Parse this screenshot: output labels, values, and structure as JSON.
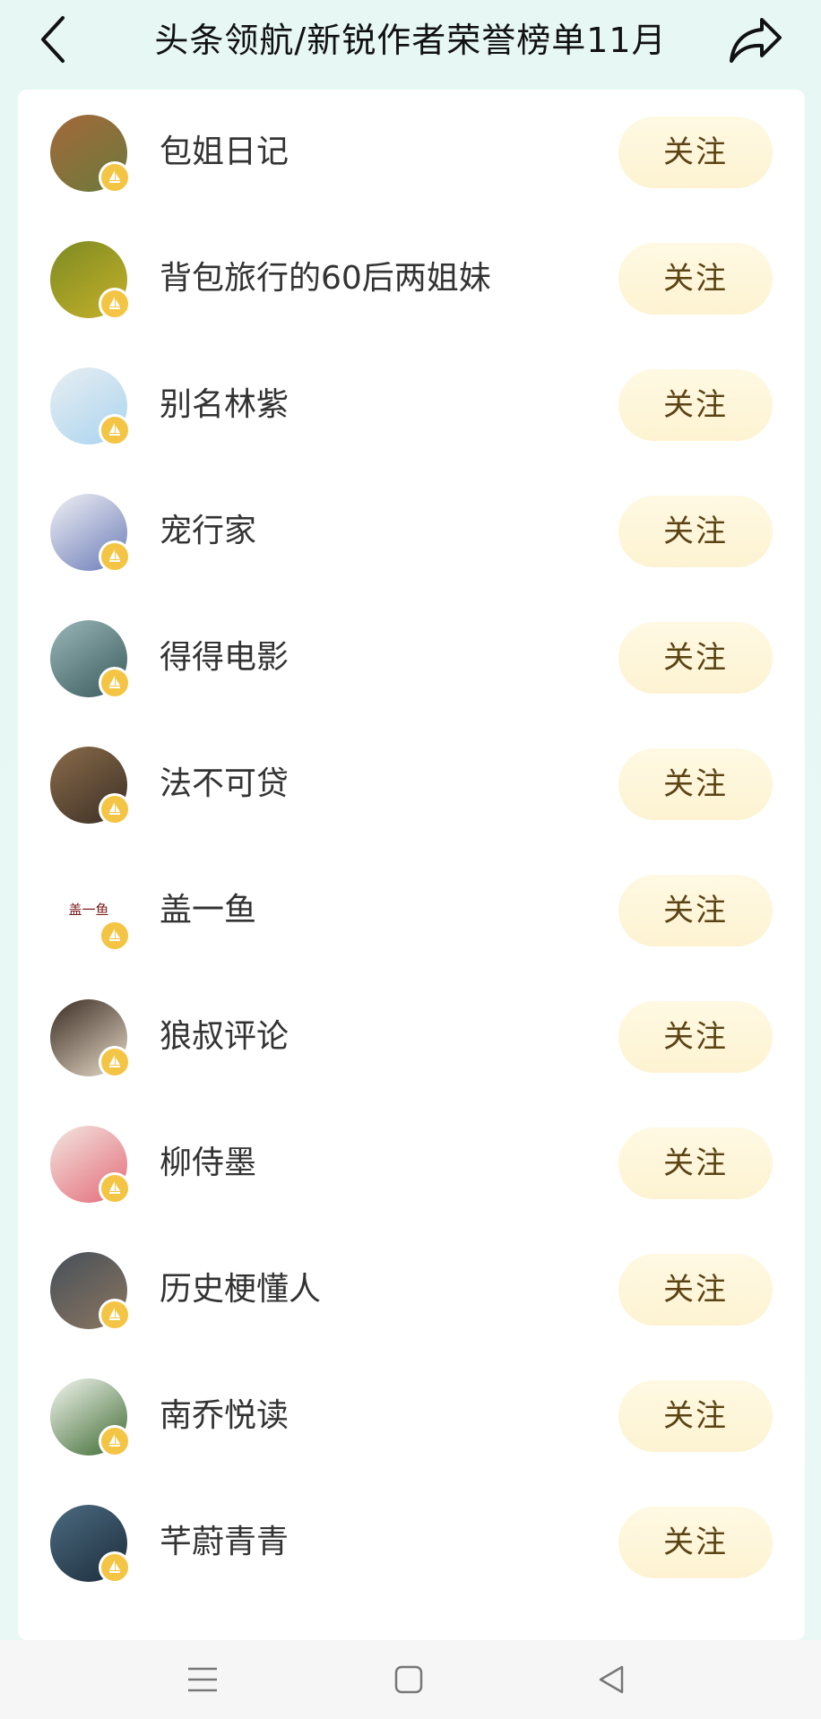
{
  "header": {
    "title": "头条领航/新锐作者荣誉榜单11月",
    "back_icon": "chevron-left-icon",
    "share_icon": "share-arrow-icon"
  },
  "colors": {
    "page_bg": "#e8f8f4",
    "button_bg": "#fdf4d4",
    "button_text": "#5b4314",
    "badge": "#f4c544"
  },
  "authors": [
    {
      "name": "包姐日记",
      "follow_label": "关注",
      "avatar_colors": [
        "#6b7a3c",
        "#a4683a"
      ]
    },
    {
      "name": "背包旅行的60后两姐妹",
      "follow_label": "关注",
      "avatar_colors": [
        "#c6b12a",
        "#7c8a22"
      ]
    },
    {
      "name": "别名林紫",
      "follow_label": "关注",
      "avatar_colors": [
        "#a9d4ef",
        "#e9eef2"
      ]
    },
    {
      "name": "宠行家",
      "follow_label": "关注",
      "avatar_colors": [
        "#6b7cb8",
        "#f0f0f4"
      ]
    },
    {
      "name": "得得电影",
      "follow_label": "关注",
      "avatar_colors": [
        "#3a5a5c",
        "#9ab7b8"
      ]
    },
    {
      "name": "法不可贷",
      "follow_label": "关注",
      "avatar_colors": [
        "#3c3026",
        "#8a6b4a"
      ]
    },
    {
      "name": "盖一鱼",
      "follow_label": "关注",
      "avatar_colors": [
        "#ffffff",
        "#ffffff"
      ],
      "avatar_text": "盖一鱼"
    },
    {
      "name": "狼叔评论",
      "follow_label": "关注",
      "avatar_colors": [
        "#e7dbc9",
        "#3a2c22"
      ]
    },
    {
      "name": "柳侍墨",
      "follow_label": "关注",
      "avatar_colors": [
        "#e46a78",
        "#f2e6e0"
      ]
    },
    {
      "name": "历史梗懂人",
      "follow_label": "关注",
      "avatar_colors": [
        "#8c7660",
        "#46505a"
      ]
    },
    {
      "name": "南乔悦读",
      "follow_label": "关注",
      "avatar_colors": [
        "#3c6a30",
        "#f4f6f0"
      ]
    },
    {
      "name": "芊蔚青青",
      "follow_label": "关注",
      "avatar_colors": [
        "#1c2e3c",
        "#4c6a80"
      ]
    }
  ],
  "navbar": {
    "menu_icon": "menu-lines-icon",
    "home_icon": "square-home-icon",
    "back_icon": "triangle-back-icon"
  }
}
